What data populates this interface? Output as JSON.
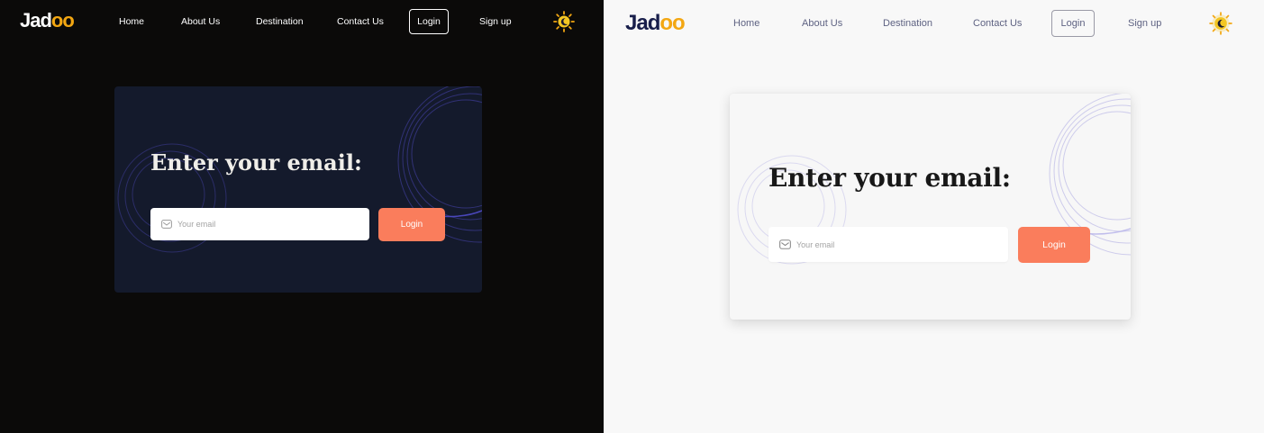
{
  "brand": {
    "logo_text_prefix": "Jad",
    "logo_text_suffix": "oo"
  },
  "nav": {
    "links": [
      "Home",
      "About Us",
      "Destination",
      "Contact Us"
    ],
    "login_label": "Login",
    "signup_label": "Sign up"
  },
  "form": {
    "title": "Enter your email:",
    "email_placeholder": "Your email",
    "email_value": "",
    "submit_label": "Login"
  },
  "icons": {
    "theme_toggle": "sun-moon-icon",
    "email": "mail-icon"
  },
  "colors": {
    "accent": "#fa7d5c",
    "logo_accent": "#f3a712",
    "dark_bg": "#0b0a09",
    "dark_card": "#141a2c",
    "light_bg": "#f8f8f8",
    "light_card": "#f7f7f7"
  },
  "panels": {
    "left_theme": "dark",
    "right_theme": "light"
  }
}
